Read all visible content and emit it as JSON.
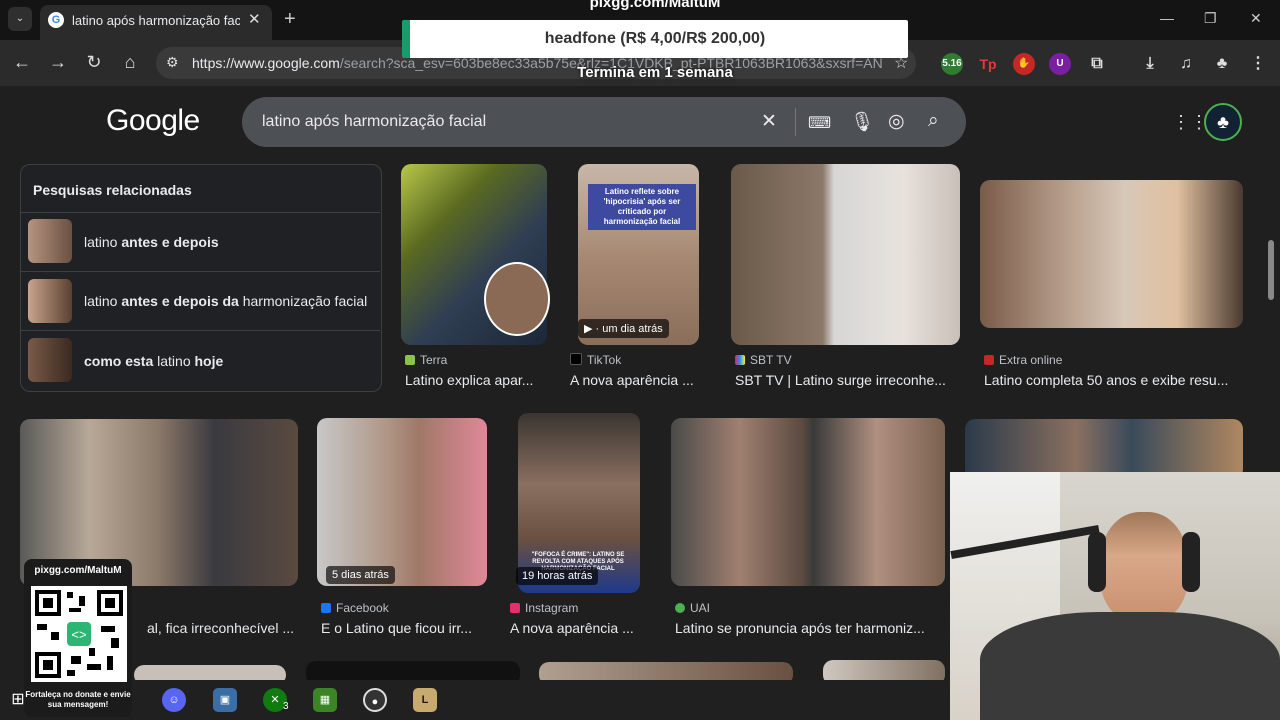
{
  "browser": {
    "tab_title": "latino após harmonização facial",
    "url_domain": "https://www.google.com",
    "url_rest": "/search?sca_esv=603be8ec33a5b75e&rlz=1C1VDKB_pt-PTBR1063BR1063&sxsrf=AN...",
    "extension_badge": "5.16"
  },
  "search": {
    "logo": "Google",
    "query": "latino após harmonização facial"
  },
  "related": {
    "title": "Pesquisas relacionadas",
    "items": [
      {
        "prefix": "latino ",
        "bold": "antes e depois",
        "suffix": ""
      },
      {
        "prefix": "latino ",
        "bold": "antes e depois da",
        "suffix": " harmonização facial"
      },
      {
        "prefix": "",
        "bold": "como esta",
        "suffix": " latino ",
        "bold2": "hoje"
      }
    ]
  },
  "results_row1": [
    {
      "source": "Terra",
      "title": "Latino explica apar...",
      "badge": "",
      "color": "#8bc34a"
    },
    {
      "source": "TikTok",
      "title": "A nova aparência ...",
      "badge": "▶ · um dia atrás",
      "color": "#000000",
      "overlay_text": "Latino reflete sobre 'hipocrisia' após ser criticado por harmonização facial"
    },
    {
      "source": "SBT TV",
      "title": "SBT TV | Latino surge irreconhe...",
      "badge": "",
      "color": "#e91e63"
    },
    {
      "source": "Extra online",
      "title": "Latino completa 50 anos e exibe resu...",
      "badge": "",
      "color": "#c62828"
    }
  ],
  "results_row2": [
    {
      "source": "",
      "title": "al, fica irreconhecível ...",
      "badge": ""
    },
    {
      "source": "Facebook",
      "title": "E o Latino que ficou irr...",
      "badge": "5 dias atrás",
      "color": "#1877f2"
    },
    {
      "source": "Instagram",
      "title": "A nova aparência ...",
      "badge": "19 horas atrás",
      "color": "#e1306c",
      "caption": "\"FOFOCA É CRIME\": LATINO SE REVOLTA COM ATAQUES APÓS HARMONIZAÇÃO FACIAL"
    },
    {
      "source": "UAI",
      "title": "Latino se pronuncia após ter harmoniz...",
      "badge": "",
      "color": "#4caf50"
    }
  ],
  "overlay": {
    "banner_top": "pixgg.com/MaltuM",
    "banner_text": "headfone (R$ 4,00/R$ 200,00)",
    "banner_bottom": "Termina em 1 semana",
    "qr_head": "pixgg.com/MaltuM",
    "qr_foot": "Fortaleça no donate e envie sua mensagem!"
  },
  "taskbar": {
    "xbox_badge": "3"
  }
}
